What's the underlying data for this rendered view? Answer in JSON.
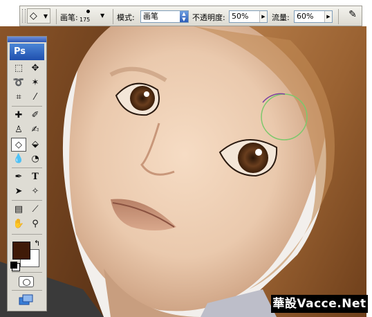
{
  "options_bar": {
    "tool_preset_icon": "eraser-icon",
    "brush_label": "画笔:",
    "brush_size": "175",
    "mode_label": "模式:",
    "mode_value": "画笔",
    "opacity_label": "不透明度:",
    "opacity_value": "50%",
    "flow_label": "流量:",
    "flow_value": "60%",
    "airbrush_icon": "airbrush-icon"
  },
  "tools_panel": {
    "logo": "Ps",
    "tools": [
      {
        "name": "marquee-icon"
      },
      {
        "name": "move-icon"
      },
      {
        "name": "lasso-icon"
      },
      {
        "name": "magic-wand-icon"
      },
      {
        "name": "crop-icon"
      },
      {
        "name": "slice-icon"
      },
      {
        "name": "healing-brush-icon"
      },
      {
        "name": "brush-icon"
      },
      {
        "name": "clone-stamp-icon"
      },
      {
        "name": "history-brush-icon"
      },
      {
        "name": "eraser-icon"
      },
      {
        "name": "paint-bucket-icon"
      },
      {
        "name": "blur-icon"
      },
      {
        "name": "dodge-icon"
      },
      {
        "name": "pen-icon"
      },
      {
        "name": "type-icon"
      },
      {
        "name": "path-selection-icon"
      },
      {
        "name": "custom-shape-icon"
      },
      {
        "name": "notes-icon"
      },
      {
        "name": "eyedropper-icon"
      },
      {
        "name": "hand-icon"
      },
      {
        "name": "zoom-icon"
      }
    ],
    "type_tool_glyph": "T",
    "foreground_color": "#3f1a08",
    "background_color": "#ffffff"
  },
  "watermark": "華設Vacce.Net"
}
